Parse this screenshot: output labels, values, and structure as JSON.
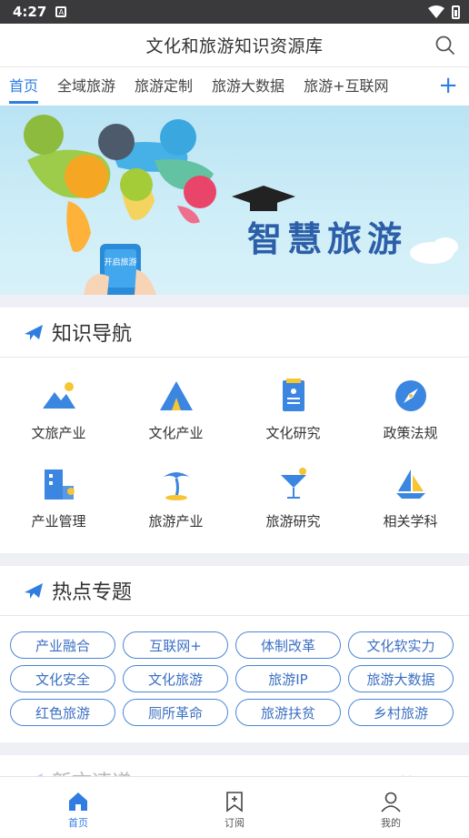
{
  "status": {
    "time": "4:27",
    "notif": "A"
  },
  "header": {
    "title": "文化和旅游知识资源库"
  },
  "tabs": [
    {
      "label": "首页",
      "active": true
    },
    {
      "label": "全域旅游"
    },
    {
      "label": "旅游定制"
    },
    {
      "label": "旅游大数据"
    },
    {
      "label": "旅游+互联网"
    }
  ],
  "tab_add": "+",
  "banner": {
    "text": "智慧旅游",
    "phone_text": "开启旅游",
    "active_dot": 2
  },
  "nav_section": {
    "title": "知识导航",
    "items": [
      {
        "label": "文旅产业",
        "icon": "mountain-icon"
      },
      {
        "label": "文化产业",
        "icon": "tent-icon"
      },
      {
        "label": "文化研究",
        "icon": "document-icon"
      },
      {
        "label": "政策法规",
        "icon": "compass-icon"
      },
      {
        "label": "产业管理",
        "icon": "building-icon"
      },
      {
        "label": "旅游产业",
        "icon": "palm-tree-icon"
      },
      {
        "label": "旅游研究",
        "icon": "cocktail-icon"
      },
      {
        "label": "相关学科",
        "icon": "sailboat-icon"
      }
    ]
  },
  "hot_section": {
    "title": "热点专题",
    "tags": [
      "产业融合",
      "互联网+",
      "体制改革",
      "文化软实力",
      "文化安全",
      "文化旅游",
      "旅游IP",
      "旅游大数据",
      "红色旅游",
      "厕所革命",
      "旅游扶贫",
      "乡村旅游"
    ]
  },
  "partial_section": {
    "title": "新文速递",
    "more": "More"
  },
  "bottom_nav": [
    {
      "label": "首页",
      "active": true
    },
    {
      "label": "订阅"
    },
    {
      "label": "我的"
    }
  ],
  "colors": {
    "accent": "#2f7de1",
    "tag_border": "#4b86d4",
    "dot_active": "#e24a3b"
  }
}
